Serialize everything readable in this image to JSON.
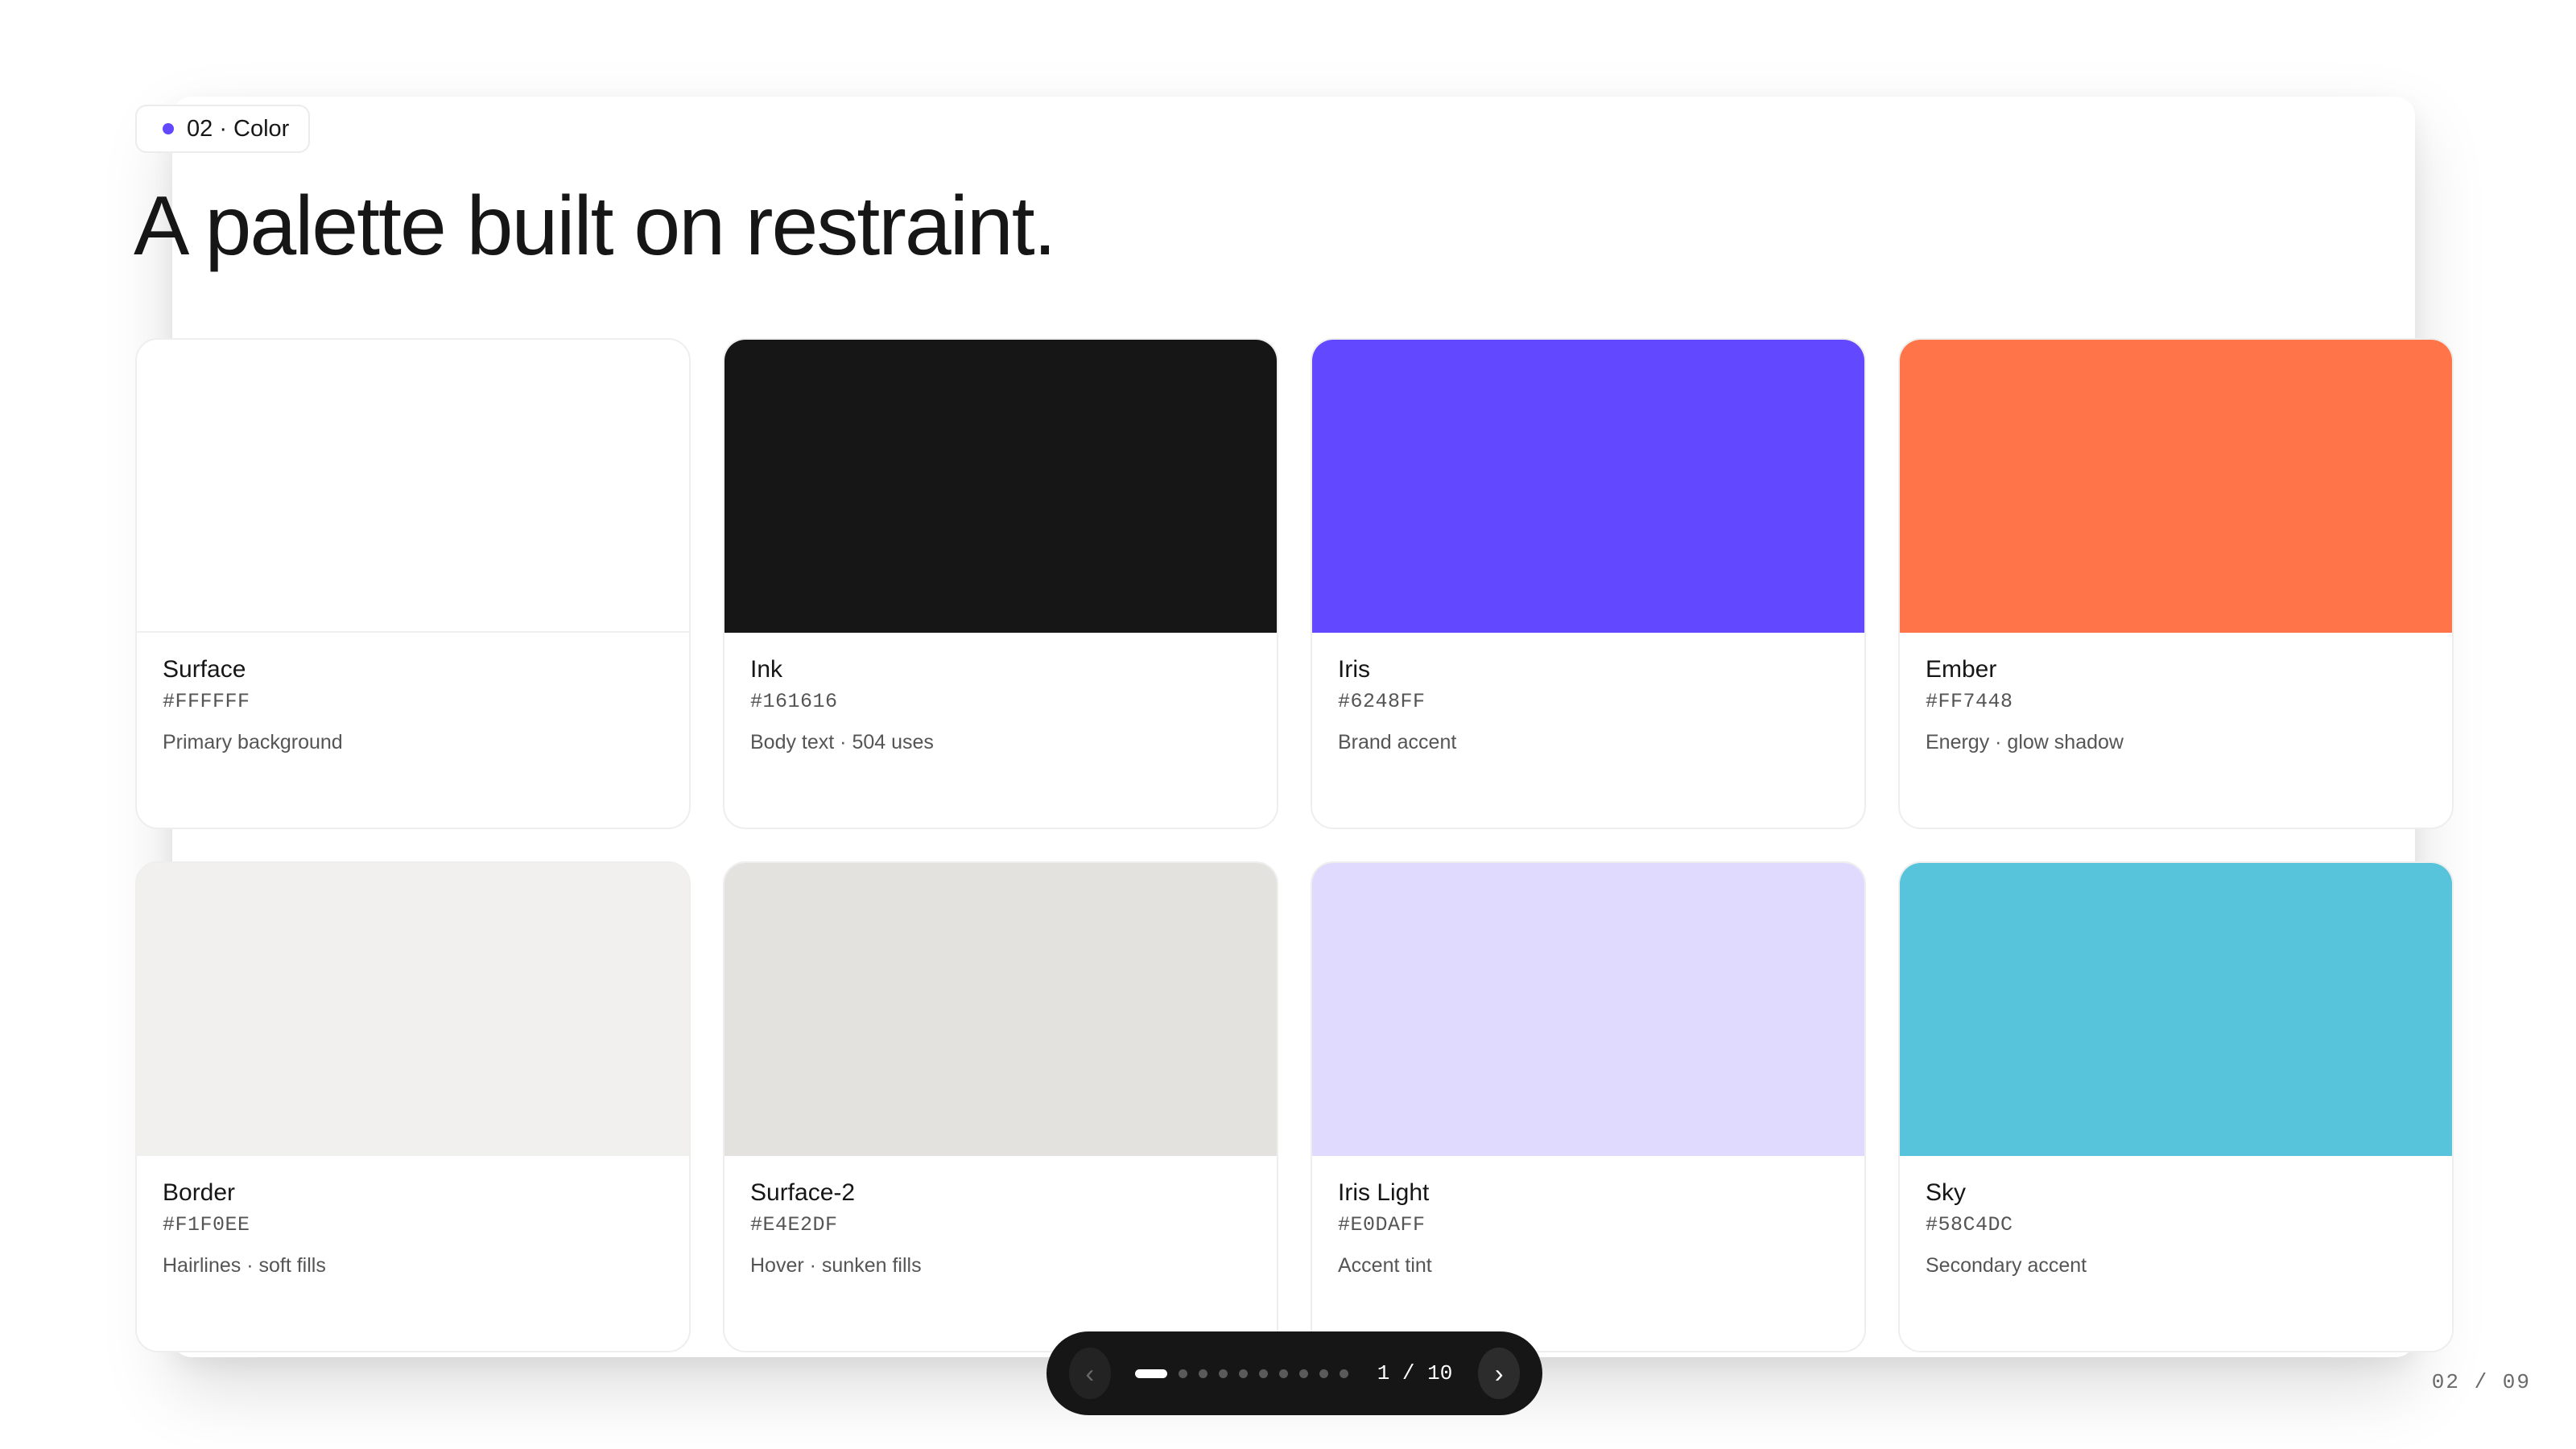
{
  "section": {
    "label": "02 · Color",
    "accent": "#6248FF"
  },
  "title": "A palette built on restraint.",
  "swatches": [
    {
      "name": "Surface",
      "hex": "#FFFFFF",
      "desc": "Primary background",
      "color": "#FFFFFF"
    },
    {
      "name": "Ink",
      "hex": "#161616",
      "desc": "Body text · 504 uses",
      "color": "#161616"
    },
    {
      "name": "Iris",
      "hex": "#6248FF",
      "desc": "Brand accent",
      "color": "#6248FF"
    },
    {
      "name": "Ember",
      "hex": "#FF7448",
      "desc": "Energy · glow shadow",
      "color": "#FF7448"
    },
    {
      "name": "Border",
      "hex": "#F1F0EE",
      "desc": "Hairlines · soft fills",
      "color": "#F1F0EE"
    },
    {
      "name": "Surface-2",
      "hex": "#E4E2DF",
      "desc": "Hover · sunken fills",
      "color": "#E4E2DF"
    },
    {
      "name": "Iris Light",
      "hex": "#E0DAFF",
      "desc": "Accent tint",
      "color": "#E0DAFF"
    },
    {
      "name": "Sky",
      "hex": "#58C4DC",
      "desc": "Secondary accent",
      "color": "#58C4DC"
    }
  ],
  "pager": {
    "prev_icon": "chevron-left-icon",
    "next_icon": "chevron-right-icon",
    "prev_glyph": "‹",
    "next_glyph": "›",
    "counter": "1 / 10",
    "current": 1,
    "total": 10
  },
  "page_number": "02 / 09"
}
